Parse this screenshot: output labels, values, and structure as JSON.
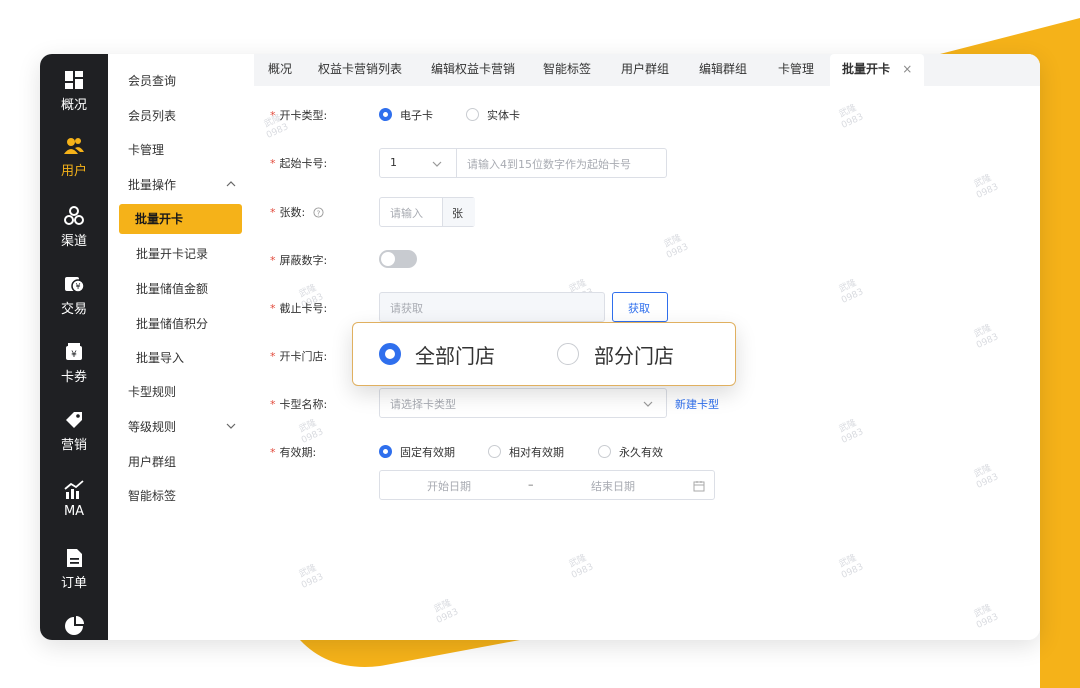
{
  "nav": {
    "items": [
      {
        "label": "概况",
        "icon": "dashboard-icon"
      },
      {
        "label": "用户",
        "icon": "users-icon",
        "active": true
      },
      {
        "label": "渠道",
        "icon": "channel-icon"
      },
      {
        "label": "交易",
        "icon": "transaction-icon"
      },
      {
        "label": "卡券",
        "icon": "coupon-icon"
      },
      {
        "label": "营销",
        "icon": "tag-icon"
      },
      {
        "label": "MA",
        "icon": "chart-icon"
      },
      {
        "label": "订单",
        "icon": "document-icon"
      },
      {
        "label": "",
        "icon": "pie-icon"
      }
    ]
  },
  "submenu": {
    "member_query": "会员查询",
    "member_list": "会员列表",
    "card_manage": "卡管理",
    "batch_ops": "批量操作",
    "batch_open_card": "批量开卡",
    "batch_open_records": "批量开卡记录",
    "batch_store_amount": "批量储值金额",
    "batch_store_points": "批量储值积分",
    "batch_import": "批量导入",
    "card_type_rules": "卡型规则",
    "level_rules": "等级规则",
    "user_groups": "用户群组",
    "smart_tags": "智能标签"
  },
  "tabs": [
    "概况",
    "权益卡营销列表",
    "编辑权益卡营销",
    "智能标签",
    "用户群组",
    "编辑群组",
    "卡管理",
    "批量开卡"
  ],
  "form": {
    "card_type_label": "开卡类型:",
    "card_type_options": [
      "电子卡",
      "实体卡"
    ],
    "start_no_label": "起始卡号:",
    "start_no_select": "1",
    "start_no_placeholder": "请输入4到15位数字作为起始卡号",
    "count_label": "张数:",
    "count_placeholder": "请输入",
    "count_unit": "张",
    "mask_label": "屏蔽数字:",
    "end_no_label": "截止卡号:",
    "end_no_placeholder": "请获取",
    "fetch_button": "获取",
    "store_label": "开卡门店:",
    "store_options": [
      "全部门店",
      "部分门店"
    ],
    "card_name_label": "卡型名称:",
    "card_name_placeholder": "请选择卡类型",
    "new_card_type": "新建卡型",
    "validity_label": "有效期:",
    "validity_options": [
      "固定有效期",
      "相对有效期",
      "永久有效"
    ],
    "start_date": "开始日期",
    "date_sep": "–",
    "end_date": "结束日期"
  },
  "watermark": {
    "line1": "武隆",
    "line2": "0983"
  },
  "colors": {
    "accent": "#f5b219",
    "primary": "#2f6fed",
    "required": "#e24a3b",
    "rail": "#1f2023"
  }
}
